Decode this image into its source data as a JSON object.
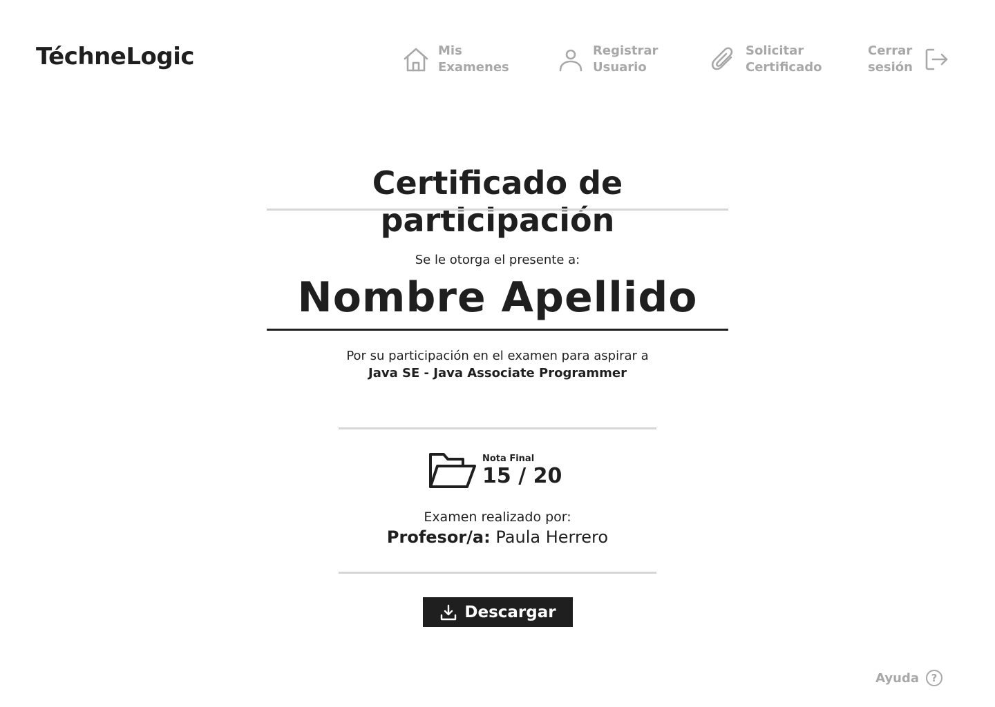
{
  "brand": {
    "name": "TéchneLogic"
  },
  "nav": {
    "items": [
      {
        "line1": "Mis",
        "line2": "Examenes",
        "icon": "home-icon"
      },
      {
        "line1": "Registrar",
        "line2": "Usuario",
        "icon": "user-icon"
      },
      {
        "line1": "Solicitar",
        "line2": "Certificado",
        "icon": "paperclip-icon"
      }
    ],
    "logout": {
      "line1": "Cerrar",
      "line2": "sesión",
      "icon": "logout-icon"
    }
  },
  "certificate": {
    "title": "Certificado de participación",
    "award_label": "Se le otorga el presente a:",
    "recipient": "Nombre Apellido",
    "description": "Por su participación en el examen para aspirar a",
    "exam_name": "Java SE - Java Associate Programmer",
    "grade_label": "Nota Final",
    "grade_value": "15 / 20",
    "grade_icon": "folder-open-icon",
    "examiner_label": "Examen realizado por:",
    "examiner_role": "Profesor/a:",
    "examiner_name": "Paula Herrero"
  },
  "actions": {
    "download_label": "Descargar",
    "download_icon": "download-icon"
  },
  "help": {
    "label": "Ayuda",
    "icon": "question-circle-icon"
  },
  "colors": {
    "dark": "#1f1f1f",
    "muted": "#a8a8a8",
    "rule": "#d6d6d6",
    "background": "#ffffff"
  }
}
